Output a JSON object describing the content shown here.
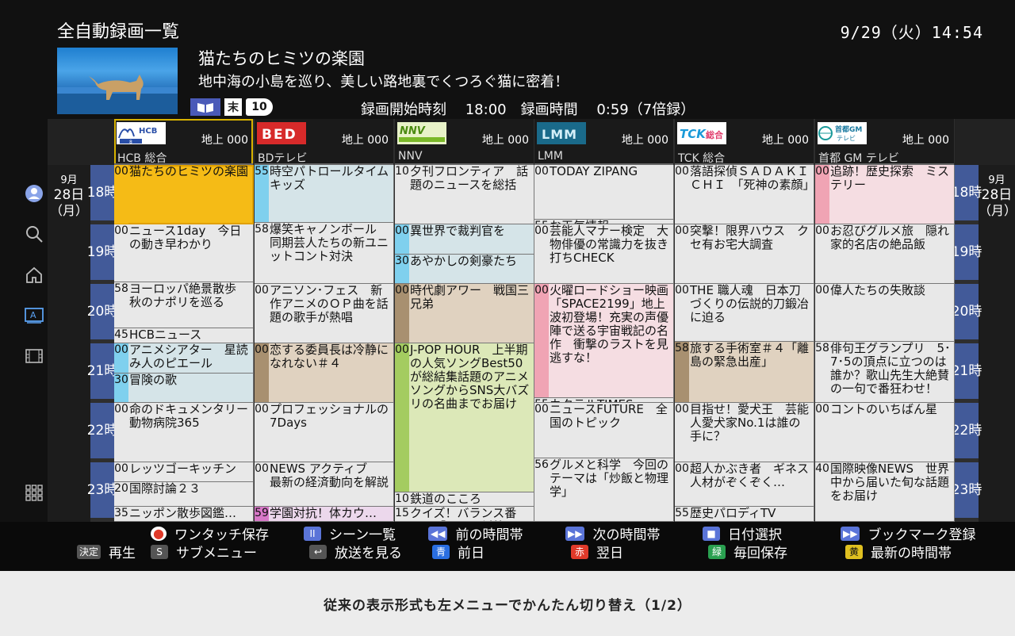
{
  "header": {
    "title": "全自動録画一覧",
    "clock": "9/29（火）14:54"
  },
  "program": {
    "title": "猫たちのヒミツの楽園",
    "description": "地中海の小島を巡り、美しい路地裏でくつろぐ猫に密着！",
    "badge_end": "末",
    "badge_10": "10",
    "rec_info": "録画開始時刻　 18:00　録画時間　 0:59（7倍録）"
  },
  "date_label": {
    "month": "9月",
    "day": "28日",
    "dow": "（月）"
  },
  "hours": [
    {
      "h": "18",
      "u": "時"
    },
    {
      "h": "19",
      "u": "時"
    },
    {
      "h": "20",
      "u": "時"
    },
    {
      "h": "21",
      "u": "時"
    },
    {
      "h": "22",
      "u": "時"
    },
    {
      "h": "23",
      "u": "時"
    }
  ],
  "channels": [
    {
      "logo": "HCB",
      "logo_sub": "8",
      "num": "地上 000",
      "name": "HCB 総合",
      "cells": [
        {
          "min": "00",
          "title": "猫たちのヒミツの楽園",
          "s": 0,
          "e": 60,
          "bg": "#f5bb16",
          "stripe": "#f5bb16"
        },
        {
          "min": "00",
          "title": "ニュース1day　今日の動き早わかり",
          "s": 60,
          "e": 118,
          "bg": "#e8e8e8"
        },
        {
          "min": "58",
          "title": "ヨーロッパ絶景散歩 秋のナポリを巡る",
          "s": 118,
          "e": 165,
          "bg": "#e8e8e8"
        },
        {
          "min": "45",
          "title": "HCBニュース",
          "s": 165,
          "e": 180,
          "bg": "#e8e8e8"
        },
        {
          "min": "00",
          "title": "アニメシアター　星読み人のピエール",
          "s": 180,
          "e": 210,
          "bg": "#d5e4e8",
          "stripe": "#7fd0ee"
        },
        {
          "min": "30",
          "title": "冒険の歌",
          "s": 210,
          "e": 240,
          "bg": "#d5e4e8",
          "stripe": "#7fd0ee"
        },
        {
          "min": "00",
          "title": "命のドキュメンタリー動物病院365",
          "s": 240,
          "e": 300,
          "bg": "#e8e8e8"
        },
        {
          "min": "00",
          "title": "レッツゴーキッチン",
          "s": 300,
          "e": 320,
          "bg": "#e8e8e8"
        },
        {
          "min": "20",
          "title": "国際討論２３",
          "s": 320,
          "e": 345,
          "bg": "#e8e8e8"
        },
        {
          "min": "35",
          "title": "ニッポン散歩図鑑…",
          "s": 345,
          "e": 360,
          "bg": "#e8e8e8"
        }
      ]
    },
    {
      "logo": "BED",
      "num": "地上 000",
      "name": "BDテレビ",
      "cells": [
        {
          "min": "55",
          "title": "時空パトロールタイムキッズ",
          "s": 0,
          "e": 58,
          "bg": "#d5e4e8",
          "stripe": "#7fd0ee"
        },
        {
          "min": "58",
          "title": "爆笑キャノンボール　同期芸人たちの新ユニットコント対決",
          "s": 58,
          "e": 120,
          "bg": "#e8e8e8"
        },
        {
          "min": "00",
          "title": "アニソン･フェス　新作アニメのＯＰ曲を話題の歌手が熱唱",
          "s": 120,
          "e": 180,
          "bg": "#e8e8e8"
        },
        {
          "min": "00",
          "title": "恋する委員長は冷静になれない＃４",
          "s": 180,
          "e": 240,
          "bg": "#e0d2c0",
          "stripe": "#a89070"
        },
        {
          "min": "00",
          "title": "プロフェッショナルの7Days",
          "s": 240,
          "e": 300,
          "bg": "#e8e8e8"
        },
        {
          "min": "00",
          "title": "NEWS アクティブ　最新の経済動向を解説",
          "s": 300,
          "e": 345,
          "bg": "#e8e8e8"
        },
        {
          "min": "59",
          "title": "学園対抗！体カウ…",
          "s": 345,
          "e": 360,
          "bg": "#ecd8ec",
          "stripe": "#d878c8"
        }
      ]
    },
    {
      "logo": "NNV",
      "num": "地上 000",
      "name": "NNV",
      "cells": [
        {
          "min": "10",
          "title": "夕刊フロンティア　話題のニュースを総括",
          "s": 0,
          "e": 60,
          "bg": "#e8e8e8"
        },
        {
          "min": "00",
          "title": "異世界で裁判官を",
          "s": 60,
          "e": 90,
          "bg": "#d5e4e8",
          "stripe": "#7fd0ee"
        },
        {
          "min": "30",
          "title": "あやかしの剣豪たち",
          "s": 90,
          "e": 120,
          "bg": "#d5e4e8",
          "stripe": "#7fd0ee"
        },
        {
          "min": "00",
          "title": "時代劇アワー　戦国三兄弟",
          "s": 120,
          "e": 180,
          "bg": "#e0d2c0",
          "stripe": "#a89070"
        },
        {
          "min": "00",
          "title": "J-POP HOUR　上半期の人気ソングBest50が総結集話題のアニメソングからSNS大バズリの名曲までお届け",
          "s": 180,
          "e": 330,
          "bg": "#dce8b8",
          "stripe": "#a4cc60"
        },
        {
          "min": "10",
          "title": "鉄道のこころ",
          "s": 330,
          "e": 345,
          "bg": "#e8e8e8"
        },
        {
          "min": "15",
          "title": "クイズ！バランス番長！「ドラマ対抗…",
          "s": 345,
          "e": 360,
          "bg": "#e8e8e8"
        }
      ]
    },
    {
      "logo": "LMM",
      "num": "地上 000",
      "name": "LMM",
      "cells": [
        {
          "min": "00",
          "title": "TODAY ZIPANG",
          "s": 0,
          "e": 55,
          "bg": "#e8e8e8"
        },
        {
          "min": "55",
          "title": "お天気情報",
          "s": 55,
          "e": 60,
          "bg": "#e8e8e8"
        },
        {
          "min": "00",
          "title": "芸能人マナー検定　大物俳優の常識力を抜き打ちCHECK",
          "s": 60,
          "e": 120,
          "bg": "#e8e8e8"
        },
        {
          "min": "00",
          "title": "火曜ロードショー映画「SPACE2199」地上波初登場！充実の声優陣で送る宇宙戦記の名作　衝撃のラストを見逃すな！",
          "s": 120,
          "e": 235,
          "bg": "#f5dde2",
          "stripe": "#f0a4b4"
        },
        {
          "min": "55",
          "title": "カクテルTIMES",
          "s": 235,
          "e": 240,
          "bg": "#e8e8e8"
        },
        {
          "min": "00",
          "title": "ニュースFUTURE　全国のトピック",
          "s": 240,
          "e": 296,
          "bg": "#e8e8e8"
        },
        {
          "min": "56",
          "title": "グルメと科学　今回のテーマは「炒飯と物理学」",
          "s": 296,
          "e": 360,
          "bg": "#e8e8e8"
        }
      ]
    },
    {
      "logo": "TCK",
      "logo_sub": "総合",
      "num": "地上 000",
      "name": "TCK 総合",
      "cells": [
        {
          "min": "00",
          "title": "落語探偵ＳＡＤＡＫＩＣＨＩ　「死神の素顔」",
          "s": 0,
          "e": 60,
          "bg": "#e8e8e8"
        },
        {
          "min": "00",
          "title": "突撃！限界ハウス　クセ有お宅大調査",
          "s": 60,
          "e": 120,
          "bg": "#e8e8e8"
        },
        {
          "min": "00",
          "title": "THE 職人魂　日本刀づくりの伝説的刀鍛冶に迫る",
          "s": 120,
          "e": 178,
          "bg": "#e8e8e8"
        },
        {
          "min": "58",
          "title": "旅する手術室＃４「離島の緊急出産」",
          "s": 178,
          "e": 240,
          "bg": "#e0d2c0",
          "stripe": "#a89070"
        },
        {
          "min": "00",
          "title": "目指せ！愛犬王　芸能人愛犬家No.1は誰の手に？",
          "s": 240,
          "e": 300,
          "bg": "#e8e8e8"
        },
        {
          "min": "00",
          "title": "超人かぶき者　ギネス人材がぞくぞく…",
          "s": 300,
          "e": 345,
          "bg": "#e8e8e8"
        },
        {
          "min": "55",
          "title": "歴史パロディTV",
          "s": 345,
          "e": 360,
          "bg": "#e8e8e8"
        }
      ]
    },
    {
      "logo": "首都GM",
      "logo_sub": "テレビ",
      "num": "地上 000",
      "name": "首都 GM テレビ",
      "cells": [
        {
          "min": "00",
          "title": "追跡！歴史探索　ミステリー",
          "s": 0,
          "e": 60,
          "bg": "#f5dde2",
          "stripe": "#f0a4b4"
        },
        {
          "min": "00",
          "title": "お忍びグルメ旅　隠れ家的名店の絶品飯",
          "s": 60,
          "e": 120,
          "bg": "#e8e8e8"
        },
        {
          "min": "00",
          "title": "偉人たちの失敗談",
          "s": 120,
          "e": 178,
          "bg": "#e8e8e8"
        },
        {
          "min": "58",
          "title": "俳句王グランプリ　5･7･5の頂点に立つのは誰か？歌山先生大絶賛の一句で番狂わせ！",
          "s": 178,
          "e": 240,
          "bg": "#e8e8e8"
        },
        {
          "min": "00",
          "title": "コントのいちばん星",
          "s": 240,
          "e": 300,
          "bg": "#e8e8e8"
        },
        {
          "min": "40",
          "title": "国際映像NEWS　世界中から届いた旬な話題をお届け",
          "s": 300,
          "e": 360,
          "bg": "#e8e8e8"
        }
      ]
    }
  ],
  "footer": {
    "row1": [
      {
        "name": "one-touch-save",
        "key": "●",
        "color": "#e03a2a",
        "label": "ワンタッチ保存"
      },
      {
        "name": "scene-list",
        "key": "II",
        "color": "#5a74d8",
        "label": "シーン一覧"
      },
      {
        "name": "prev-slot",
        "key": "◀◀",
        "color": "#5a74d8",
        "label": "前の時間帯"
      },
      {
        "name": "next-slot",
        "key": "▶▶",
        "color": "#5a74d8",
        "label": "次の時間帯"
      },
      {
        "name": "date-select",
        "key": "■",
        "color": "#5a74d8",
        "label": "日付選択"
      },
      {
        "name": "bookmark",
        "key": "▶▶",
        "color": "#5a74d8",
        "label": "ブックマーク登録"
      }
    ],
    "row2": [
      {
        "name": "play",
        "key": "決定",
        "color": "#555",
        "label": "再生"
      },
      {
        "name": "submenu",
        "key": "S",
        "color": "#555",
        "label": "サブメニュー"
      },
      {
        "name": "watch-broadcast",
        "key": "↩",
        "color": "#555",
        "label": "放送を見る"
      },
      {
        "name": "prev-day",
        "key": "青",
        "color": "#2a6ee0",
        "label": "前日"
      },
      {
        "name": "next-day",
        "key": "赤",
        "color": "#e03a2a",
        "label": "翌日"
      },
      {
        "name": "series-save",
        "key": "緑",
        "color": "#2aa050",
        "label": "毎回保存"
      },
      {
        "name": "latest-slot",
        "key": "黄",
        "color": "#e0c020",
        "label": "最新の時間帯"
      }
    ]
  },
  "caption": "従来の表示形式も左メニューでかんたん切り替え（1/2）"
}
